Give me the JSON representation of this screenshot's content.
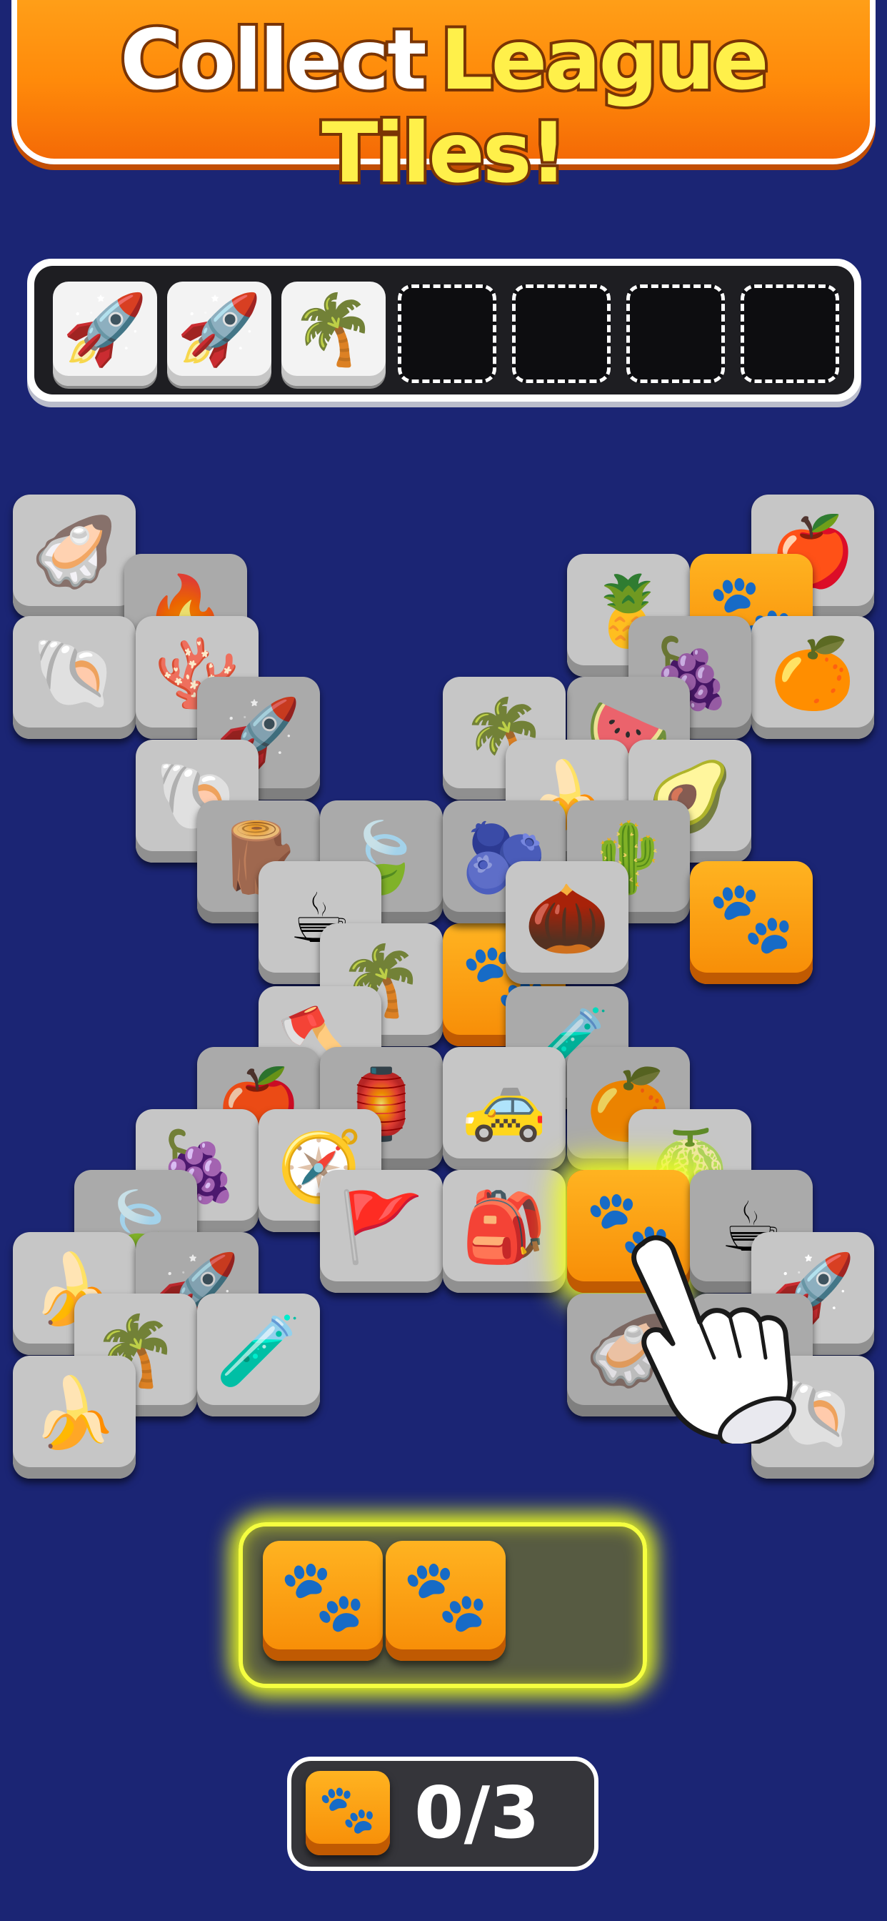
{
  "banner": {
    "title_part1": "Collect",
    "title_part2": "League Tiles!"
  },
  "tray": {
    "slots": [
      {
        "state": "filled",
        "icon": "rocket-icon",
        "glyph": "🚀"
      },
      {
        "state": "filled",
        "icon": "rocket-icon",
        "glyph": "🚀"
      },
      {
        "state": "filled",
        "icon": "palm-tree-icon",
        "glyph": "🌴"
      },
      {
        "state": "empty"
      },
      {
        "state": "empty"
      },
      {
        "state": "empty"
      },
      {
        "state": "empty"
      }
    ]
  },
  "board": {
    "tiles": [
      {
        "icon": "oyster-pearl-icon",
        "glyph": "🦪"
      },
      {
        "icon": "fire-icon",
        "glyph": "🔥"
      },
      {
        "icon": "scallop-shell-icon",
        "glyph": "🐚"
      },
      {
        "icon": "coral-icon",
        "glyph": "🪸"
      },
      {
        "icon": "rocket-icon",
        "glyph": "🚀"
      },
      {
        "icon": "scallop-shell-icon",
        "glyph": "🐚"
      },
      {
        "icon": "wood-log-icon",
        "glyph": "🪵"
      },
      {
        "icon": "leaf-icon",
        "glyph": "🍃"
      },
      {
        "icon": "coffee-cup-icon",
        "glyph": "☕"
      },
      {
        "icon": "palm-tree-icon",
        "glyph": "🌴"
      },
      {
        "icon": "paw-icon",
        "glyph": "🐾"
      },
      {
        "icon": "axe-icon",
        "glyph": "🪓"
      },
      {
        "icon": "apple-icon",
        "glyph": "🍎"
      },
      {
        "icon": "lantern-icon",
        "glyph": "🏮"
      },
      {
        "icon": "grapes-icon",
        "glyph": "🍇"
      },
      {
        "icon": "compass-icon",
        "glyph": "🧭"
      },
      {
        "icon": "flag-icon",
        "glyph": "🚩"
      },
      {
        "icon": "leaf-icon",
        "glyph": "🍃"
      },
      {
        "icon": "banana-icon",
        "glyph": "🍌"
      },
      {
        "icon": "rocket-icon",
        "glyph": "🚀"
      },
      {
        "icon": "palm-tree-icon",
        "glyph": "🌴"
      },
      {
        "icon": "potion-bottle-icon",
        "glyph": "🧪"
      },
      {
        "icon": "banana-icon",
        "glyph": "🍌"
      },
      {
        "icon": "apple-icon",
        "glyph": "🍎"
      },
      {
        "icon": "pineapple-icon",
        "glyph": "🍍"
      },
      {
        "icon": "paw-icon",
        "glyph": "🐾"
      },
      {
        "icon": "orange-icon",
        "glyph": "🍊"
      },
      {
        "icon": "grapes-icon",
        "glyph": "🍇"
      },
      {
        "icon": "watermelon-icon",
        "glyph": "🍉"
      },
      {
        "icon": "palm-tree-icon",
        "glyph": "🌴"
      },
      {
        "icon": "banana-icon",
        "glyph": "🍌"
      },
      {
        "icon": "avocado-icon",
        "glyph": "🥑"
      },
      {
        "icon": "blueberry-icon",
        "glyph": "🫐"
      },
      {
        "icon": "cactus-icon",
        "glyph": "🌵"
      },
      {
        "icon": "pinecone-icon",
        "glyph": "🌰"
      },
      {
        "icon": "paw-icon",
        "glyph": "🐾"
      },
      {
        "icon": "potion-bottle-icon",
        "glyph": "🧪"
      },
      {
        "icon": "taxi-icon",
        "glyph": "🚕"
      },
      {
        "icon": "orange-icon",
        "glyph": "🍊"
      },
      {
        "icon": "melon-icon",
        "glyph": "🍈"
      },
      {
        "icon": "backpack-icon",
        "glyph": "🎒"
      },
      {
        "icon": "paw-icon",
        "glyph": "🐾"
      },
      {
        "icon": "coffee-cup-icon",
        "glyph": "☕"
      },
      {
        "icon": "rocket-icon",
        "glyph": "🚀"
      },
      {
        "icon": "oyster-pearl-icon",
        "glyph": "🦪"
      },
      {
        "icon": "leaf-icon",
        "glyph": "🍃"
      },
      {
        "icon": "scallop-shell-icon",
        "glyph": "🐚"
      }
    ]
  },
  "collect_area": {
    "tiles": [
      {
        "icon": "paw-icon",
        "glyph": "🐾"
      },
      {
        "icon": "paw-icon",
        "glyph": "🐾"
      }
    ]
  },
  "counter": {
    "icon": "paw-icon",
    "glyph": "🐾",
    "text": "0/3"
  },
  "colors": {
    "background": "#1b2574",
    "banner_orange": "#ff8a0a",
    "highlight_yellow": "#f2ff1f",
    "paw_tile": "#f78b05"
  }
}
